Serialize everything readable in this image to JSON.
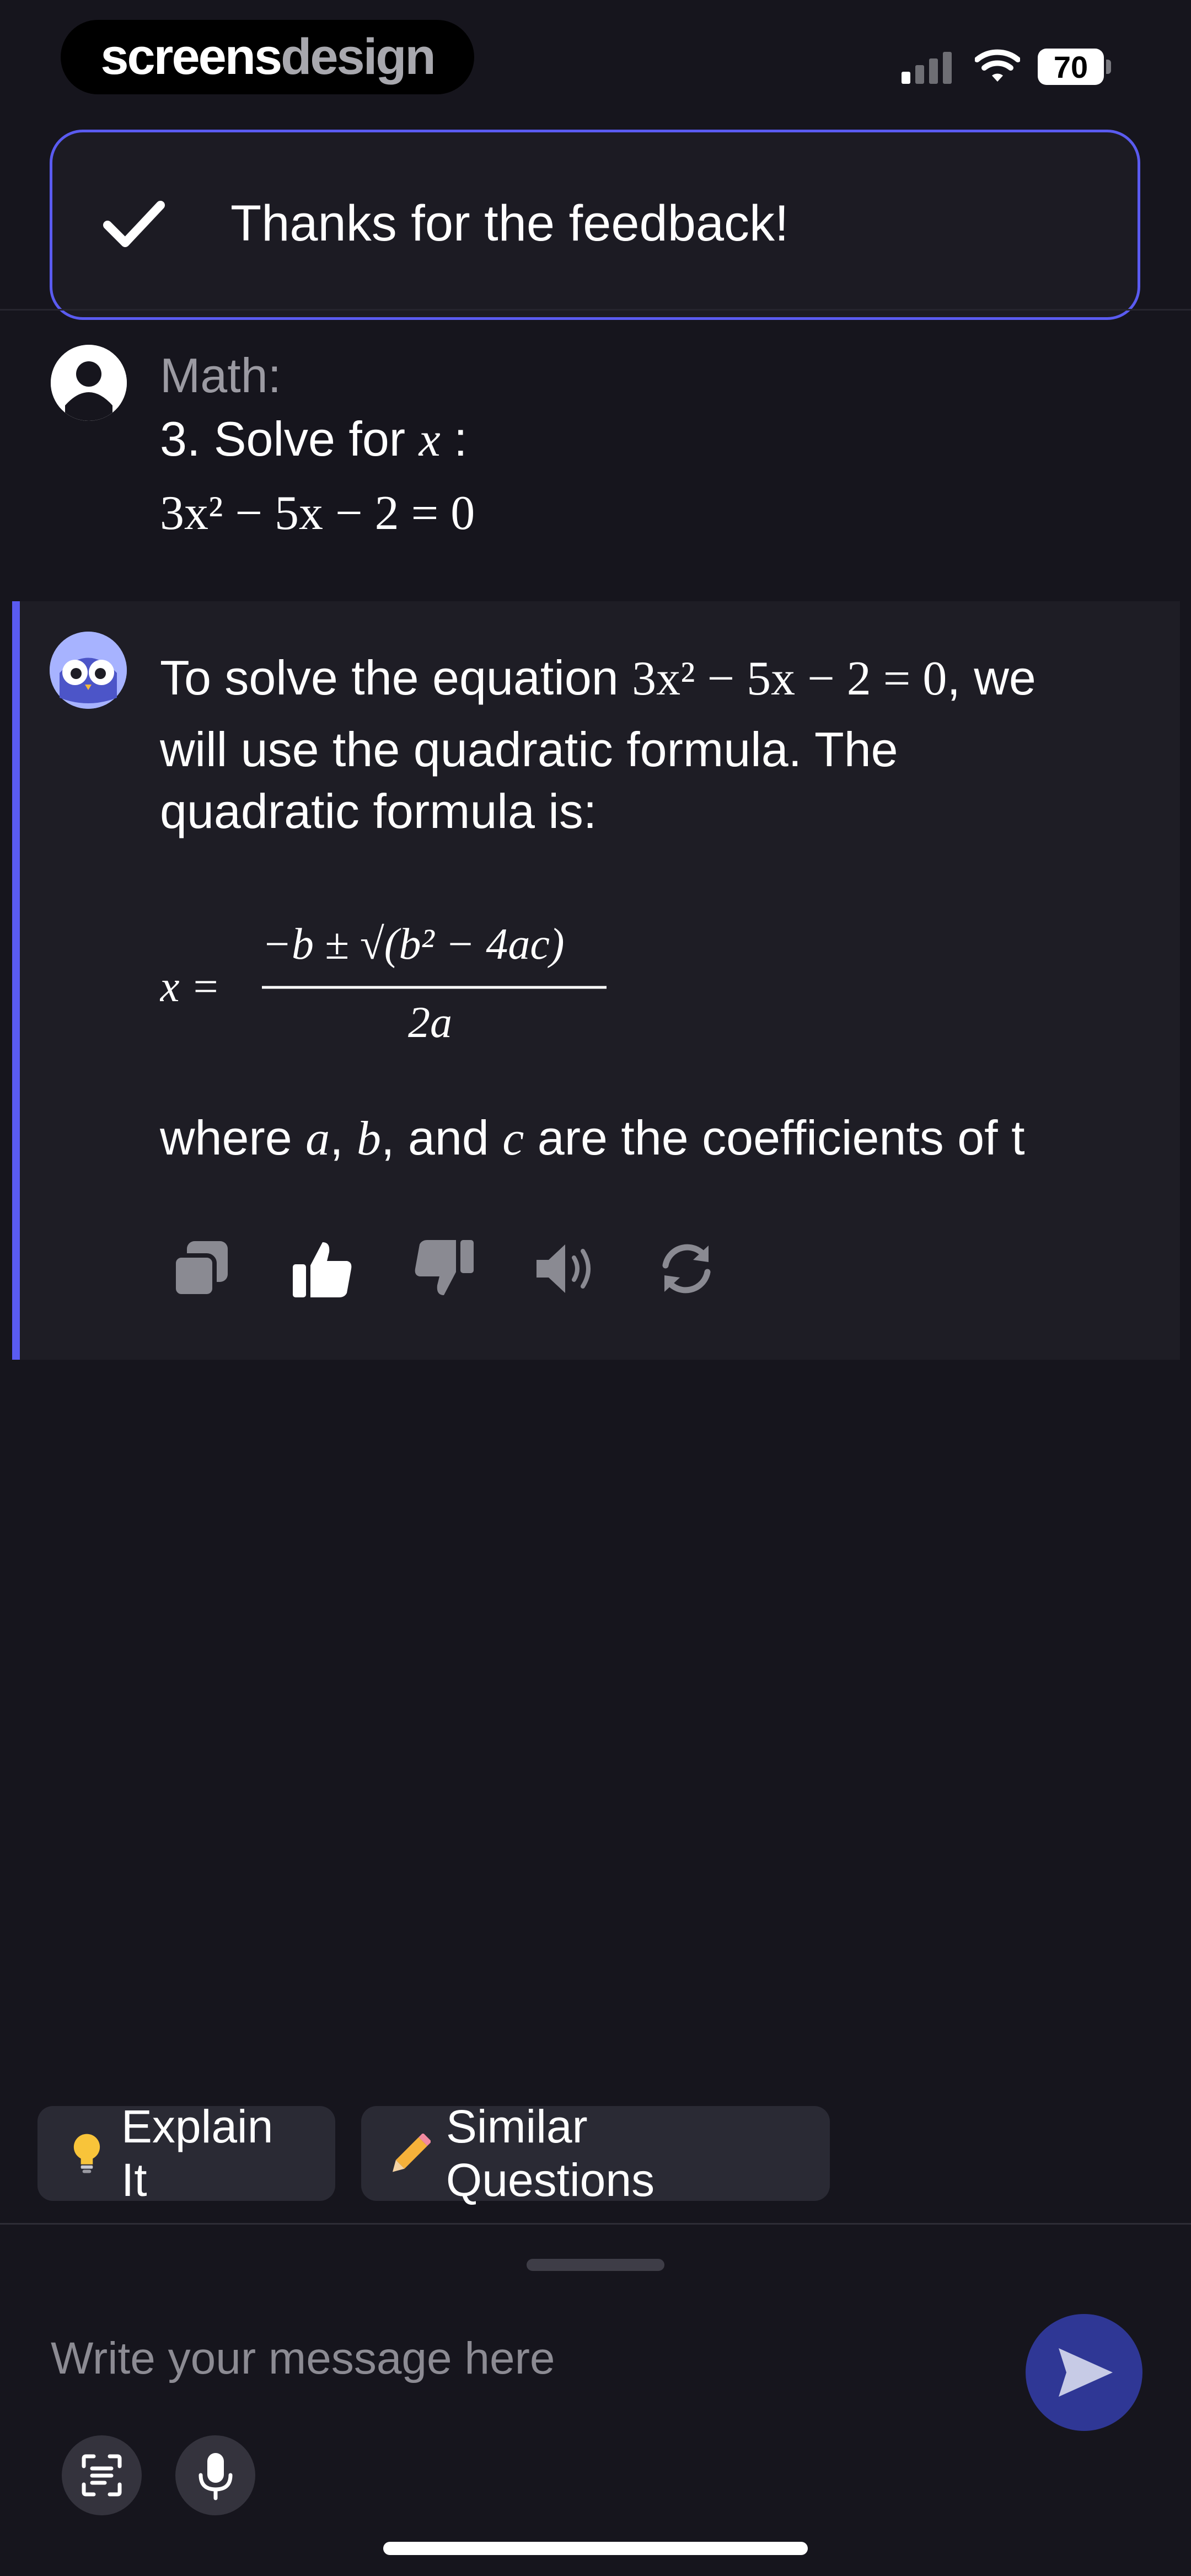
{
  "status_bar": {
    "brand_part1": "screens",
    "brand_part2": "design",
    "battery": "70",
    "icons": [
      "signal-icon",
      "wifi-icon",
      "battery-icon"
    ]
  },
  "toast": {
    "icon": "check-icon",
    "message": "Thanks for the feedback!"
  },
  "question": {
    "label": "Math:",
    "line_prefix": "3. Solve for",
    "variable": "x",
    "line_suffix": " :",
    "equation": "3x² − 5x − 2 = 0"
  },
  "answer": {
    "line1_prefix": "To solve the equation",
    "line1_equation": "3x² − 5x − 2 = 0",
    "line1_suffix": ", we",
    "line2": "will use the quadratic formula. The",
    "line3": "quadratic formula is:",
    "formula_lhs": "x =",
    "formula_numerator": "−b ± √(b² − 4ac)",
    "formula_denominator": "2a",
    "line4_prefix": "where",
    "coef_a": "a",
    "coef_b": "b",
    "coef_c": "c",
    "line4_mid": "and",
    "line4_suffix": "are the coefficients of t"
  },
  "actions": [
    "copy-icon",
    "thumbs-up-icon",
    "thumbs-down-icon",
    "speaker-icon",
    "regenerate-icon"
  ],
  "suggestions": [
    {
      "icon": "lightbulb-icon",
      "label": "Explain It"
    },
    {
      "icon": "pencil-icon",
      "label": "Similar Questions"
    }
  ],
  "composer": {
    "placeholder": "Write your message here",
    "tools": [
      "scan-text-icon",
      "microphone-icon"
    ],
    "send_icon": "send-icon"
  },
  "colors": {
    "background": "#16151d",
    "accent": "#5a5bf0",
    "card": "#1e1d25",
    "send_button": "#2f3795"
  }
}
